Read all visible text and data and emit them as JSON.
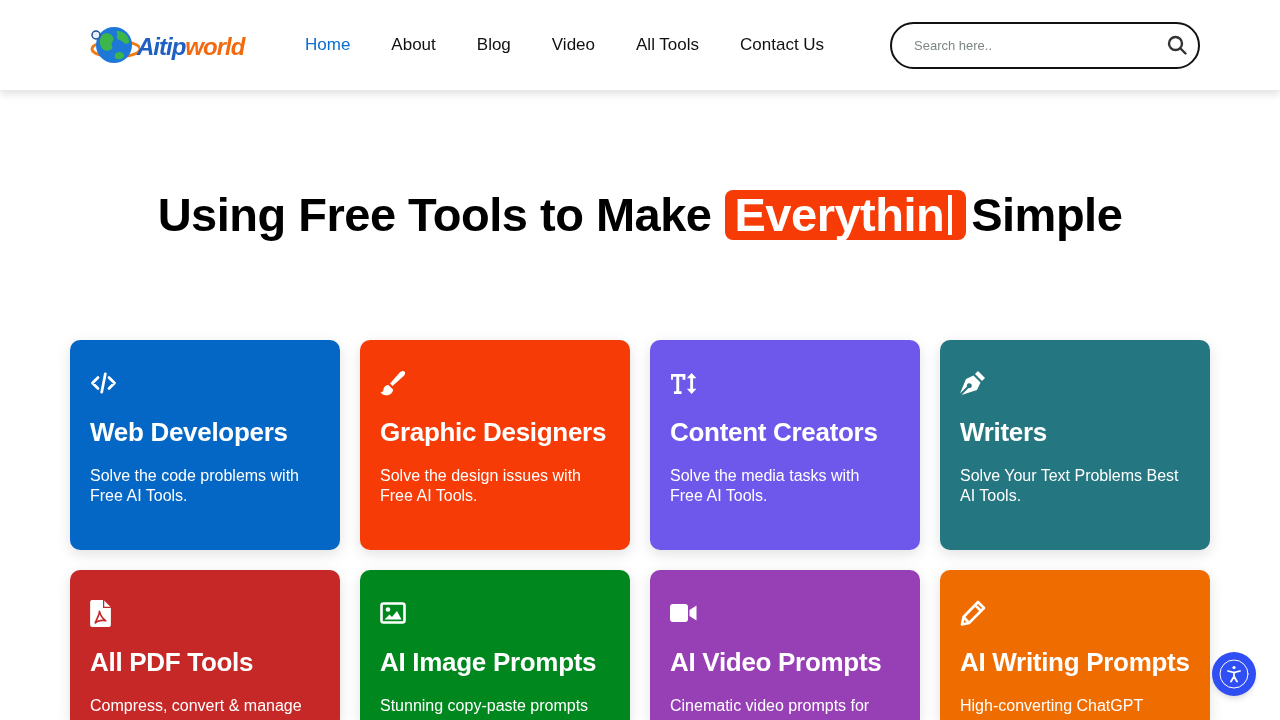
{
  "header": {
    "logo": {
      "text_start": "Aitip",
      "text_end": "world"
    },
    "nav": [
      {
        "label": "Home",
        "selected": true
      },
      {
        "label": "About",
        "selected": false
      },
      {
        "label": "Blog",
        "selected": false
      },
      {
        "label": "Video",
        "selected": false
      },
      {
        "label": "All Tools",
        "selected": false
      },
      {
        "label": "Contact Us",
        "selected": false
      }
    ],
    "search": {
      "placeholder": "Search here.."
    }
  },
  "hero": {
    "before": "Using Free Tools to Make",
    "highlight": "Everythin",
    "cursor": true,
    "after": "Simple"
  },
  "cards": [
    {
      "title": "Web Developers",
      "description": "Solve the code problems with Free AI Tools.",
      "color": "#0567c5"
    },
    {
      "title": "Graphic Designers",
      "description": "Solve the design issues with Free AI Tools.",
      "color": "#f63b07"
    },
    {
      "title": "Content Creators",
      "description": "Solve the media tasks with Free AI Tools.",
      "color": "#6e58eb"
    },
    {
      "title": "Writers",
      "description": "Solve Your Text Problems Best AI Tools.",
      "color": "#247680"
    },
    {
      "title": "All PDF Tools",
      "description": "Compress, convert & manage",
      "color": "#c62828"
    },
    {
      "title": "AI Image Prompts",
      "description": "Stunning copy-paste prompts",
      "color": "#00881f"
    },
    {
      "title": "AI Video Prompts",
      "description": "Cinematic video prompts for",
      "color": "#9740b5"
    },
    {
      "title": "AI Writing Prompts",
      "description": "High-converting ChatGPT",
      "color": "#ef6c00"
    }
  ]
}
